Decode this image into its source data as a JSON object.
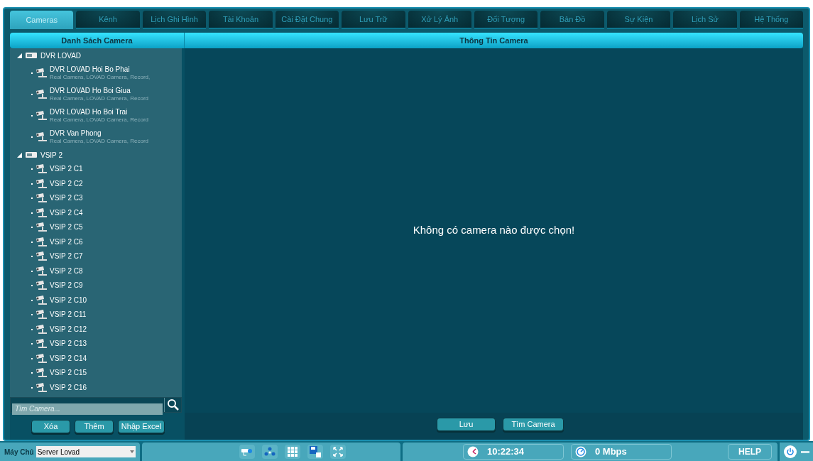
{
  "tabs": [
    {
      "label": "Cameras",
      "selected": true
    },
    {
      "label": "Kênh",
      "selected": false
    },
    {
      "label": "Lịch Ghi Hình",
      "selected": false
    },
    {
      "label": "Tài Khoản",
      "selected": false
    },
    {
      "label": "Cài Đặt Chung",
      "selected": false
    },
    {
      "label": "Lưu Trữ",
      "selected": false
    },
    {
      "label": "Xử Lý Ảnh",
      "selected": false
    },
    {
      "label": "Đối Tượng",
      "selected": false
    },
    {
      "label": "Bản Đồ",
      "selected": false
    },
    {
      "label": "Sự Kiện",
      "selected": false
    },
    {
      "label": "Lịch Sử",
      "selected": false
    },
    {
      "label": "Hệ Thống",
      "selected": false
    }
  ],
  "camera_list": {
    "title": "Danh Sách Camera",
    "tree": [
      {
        "label": "DVR LOVAD",
        "expanded": true,
        "children": [
          {
            "label": "DVR LOVAD Hoi Bo Phai",
            "detail": "Real Camera, LOVAD Camera, Record,"
          },
          {
            "label": "DVR LOVAD Ho Boi Giua",
            "detail": "Real Camera, LOVAD Camera, Record"
          },
          {
            "label": "DVR LOVAD Ho Boi Trai",
            "detail": "Real Camera, LOVAD Camera, Record"
          },
          {
            "label": "DVR Van Phong",
            "detail": "Real Camera, LOVAD Camera, Record"
          }
        ]
      },
      {
        "label": "VSIP 2",
        "expanded": true,
        "children": [
          {
            "label": "VSIP 2 C1"
          },
          {
            "label": "VSIP 2 C2"
          },
          {
            "label": "VSIP 2 C3"
          },
          {
            "label": "VSIP 2 C4"
          },
          {
            "label": "VSIP 2 C5"
          },
          {
            "label": "VSIP 2 C6"
          },
          {
            "label": "VSIP 2 C7"
          },
          {
            "label": "VSIP 2 C8"
          },
          {
            "label": "VSIP 2 C9"
          },
          {
            "label": "VSIP 2 C10"
          },
          {
            "label": "VSIP 2 C11"
          },
          {
            "label": "VSIP 2 C12"
          },
          {
            "label": "VSIP 2 C13"
          },
          {
            "label": "VSIP 2 C14"
          },
          {
            "label": "VSIP 2 C15"
          },
          {
            "label": "VSIP 2 C16"
          }
        ]
      }
    ],
    "search": {
      "placeholder": "Tìm Camera..."
    },
    "buttons": [
      "Xóa",
      "Thêm",
      "Nhập Excel"
    ]
  },
  "camera_info": {
    "title": "Thông Tin Camera",
    "message": "Không có camera nào được chọn!",
    "buttons": [
      "Lưu",
      "Tìm Camera"
    ]
  },
  "status_bar": {
    "server_label": "Máy Chủ",
    "server": "Server Lovad",
    "time": "10:22:34",
    "bandwidth": "0 Mbps",
    "help": "HELP"
  }
}
